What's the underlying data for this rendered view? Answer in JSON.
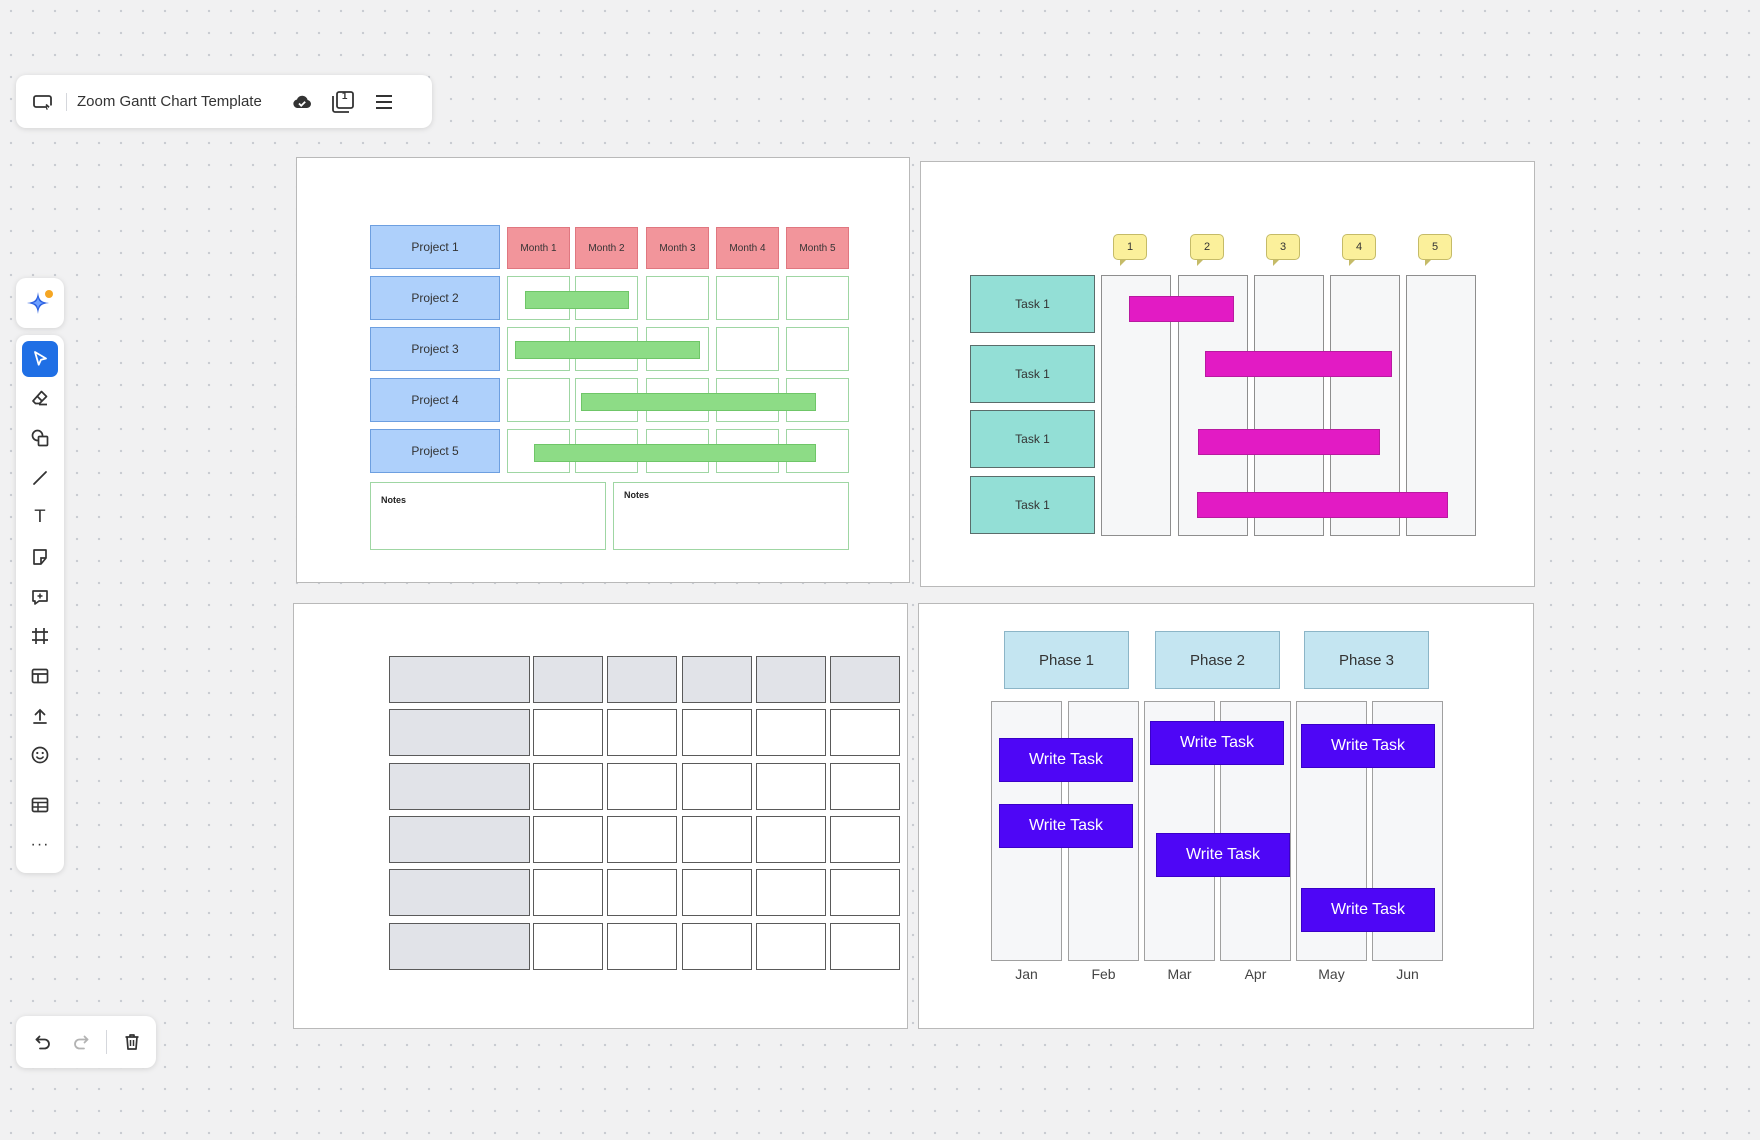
{
  "topbar": {
    "title": "Zoom Gantt Chart Template",
    "icons": [
      "screen-share-icon",
      "cloud-saved-icon",
      "page-count-icon",
      "menu-icon"
    ],
    "page_badge": "1"
  },
  "toolbar": {
    "tools": [
      "ai-sparkle-icon",
      "select-icon",
      "eraser-icon",
      "shapes-icon",
      "line-icon",
      "text-icon",
      "sticky-note-icon",
      "comment-icon",
      "frame-icon",
      "template-icon",
      "upload-icon",
      "emoji-icon",
      "table-icon",
      "more-icon"
    ],
    "text_glyph": "T",
    "more_glyph": "···"
  },
  "bottombar": {
    "icons": [
      "undo-icon",
      "redo-icon",
      "delete-icon"
    ]
  },
  "accent_color": "#1f6fe5",
  "board1": {
    "projects": [
      "Project 1",
      "Project 2",
      "Project 3",
      "Project 4",
      "Project 5"
    ],
    "months": [
      "Month 1",
      "Month 2",
      "Month 3",
      "Month 4",
      "Month 5"
    ],
    "notes": [
      "Notes",
      "Notes"
    ],
    "bar_color": "#8ddc86"
  },
  "board2": {
    "columns": [
      "1",
      "2",
      "3",
      "4",
      "5"
    ],
    "tasks": [
      "Task 1",
      "Task 1",
      "Task 1",
      "Task 1"
    ],
    "bar_color": "#e21bc4"
  },
  "board3": {
    "rows": 6,
    "cols": 5
  },
  "board4": {
    "phases": [
      "Phase 1",
      "Phase 2",
      "Phase 3"
    ],
    "months": [
      "Jan",
      "Feb",
      "Mar",
      "Apr",
      "May",
      "Jun"
    ],
    "task_label": "Write Task",
    "task_color": "#4e06f6"
  }
}
